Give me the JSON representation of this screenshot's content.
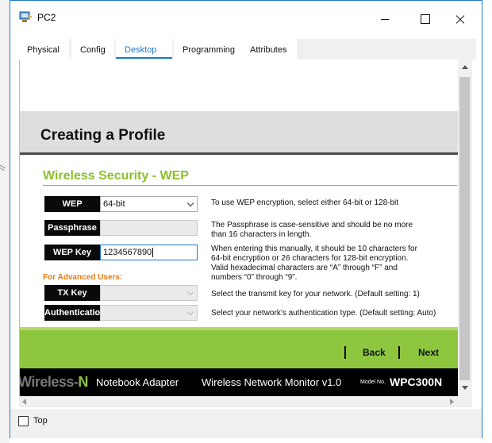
{
  "window": {
    "title": "PC2",
    "app_icon": "packet-tracer-pc-icon"
  },
  "tabs": [
    {
      "label": "Physical",
      "active": false
    },
    {
      "label": "Config",
      "active": false
    },
    {
      "label": "Desktop",
      "active": true
    },
    {
      "label": "Programming",
      "active": false
    },
    {
      "label": "Attributes",
      "active": false
    }
  ],
  "page": {
    "heading": "Creating a Profile",
    "section_title": "Wireless Security - WEP"
  },
  "form": {
    "wep": {
      "label": "WEP",
      "value": "64-bit"
    },
    "passphrase": {
      "label": "Passphrase",
      "value": ""
    },
    "wep_key": {
      "label": "WEP Key",
      "value": "1234567890"
    },
    "advanced_label": "For Advanced Users:",
    "tx_key": {
      "label": "TX Key",
      "value": ""
    },
    "authentication": {
      "label": "Authentication",
      "value": ""
    }
  },
  "descriptions": {
    "wep": "To use WEP encryption, select either 64-bit or 128-bit",
    "passphrase_1": "The Passphrase is case-sensitive and should be no more",
    "passphrase_2": "than 16 characters in length.",
    "wep_key_1": "When entering this manually, it should be 10 characters for",
    "wep_key_2": "64-bit encryption or 26 characters for 128-bit encryption.",
    "wep_key_3": "Valid hexadecimal characters are “A”  through “F” and",
    "wep_key_4": "numbers “0”  through “9”.",
    "tx_key": "Select the transmit key for your network. (Default setting: 1)",
    "authentication": "Select your network’s authentication type. (Default setting: Auto)"
  },
  "nav": {
    "back": "Back",
    "next": "Next"
  },
  "footer": {
    "brand_prefix": "Wireless-",
    "brand_suffix": "N",
    "product": "Notebook Adapter",
    "monitor": "Wireless Network Monitor  v1.0",
    "model_label": "Model No.",
    "model": "WPC300N"
  },
  "bottom": {
    "top_label": "Top",
    "top_checked": false
  },
  "colors": {
    "accent_green": "#8ec63f",
    "title_green": "#8dbf2c",
    "orange": "#e8790c",
    "tab_blue": "#1a79c9"
  }
}
